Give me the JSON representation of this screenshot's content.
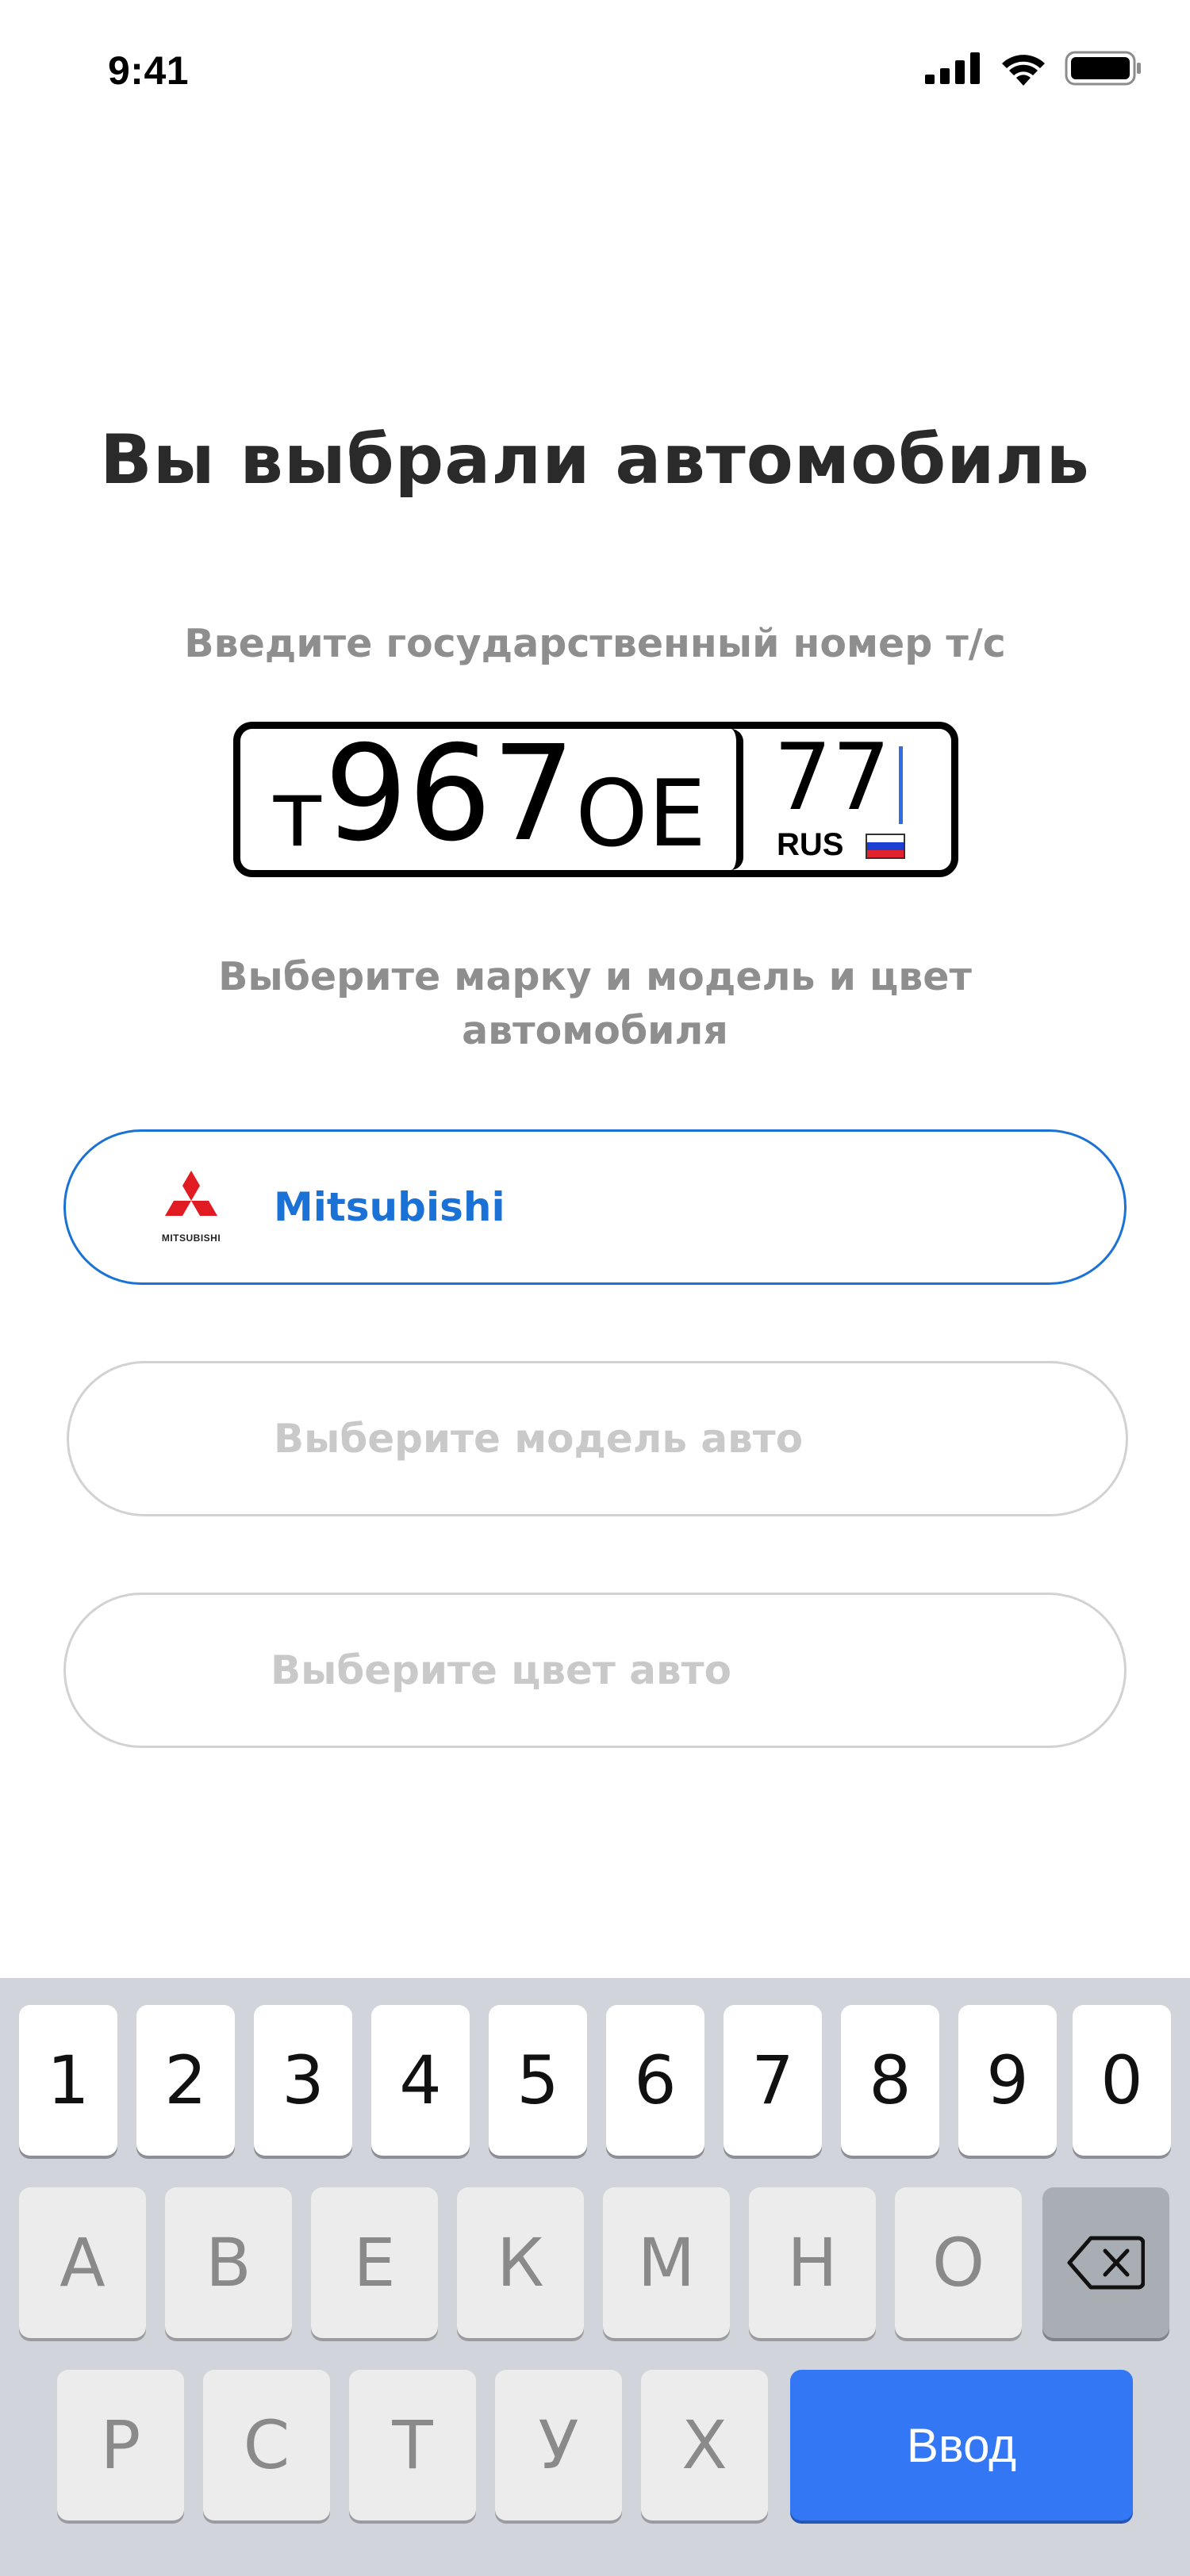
{
  "status_bar": {
    "time": "9:41"
  },
  "title": "Вы выбрали автомобиль",
  "plate_prompt": "Введите государственный номер т/с",
  "plate": {
    "letter1": "т",
    "digits": "967",
    "letters2": "ОЕ",
    "region": "77",
    "country": "RUS"
  },
  "select_prompt": {
    "line1": "Выберите марку и модель и цвет",
    "line2": "автомобиля"
  },
  "brand": {
    "name": "Mitsubishi",
    "logo_text": "MITSUBISHI"
  },
  "model_placeholder": "Выберите модель авто",
  "color_placeholder": "Выберите цвет авто",
  "keyboard": {
    "row1": [
      "1",
      "2",
      "3",
      "4",
      "5",
      "6",
      "7",
      "8",
      "9",
      "0"
    ],
    "row2": [
      "А",
      "В",
      "Е",
      "К",
      "М",
      "Н",
      "О"
    ],
    "row3": [
      "Р",
      "С",
      "Т",
      "У",
      "Х"
    ],
    "enter_label": "Ввод"
  },
  "colors": {
    "accent": "#1b72d6",
    "enter": "#3477f5",
    "keyboard_bg": "#d1d4da"
  }
}
